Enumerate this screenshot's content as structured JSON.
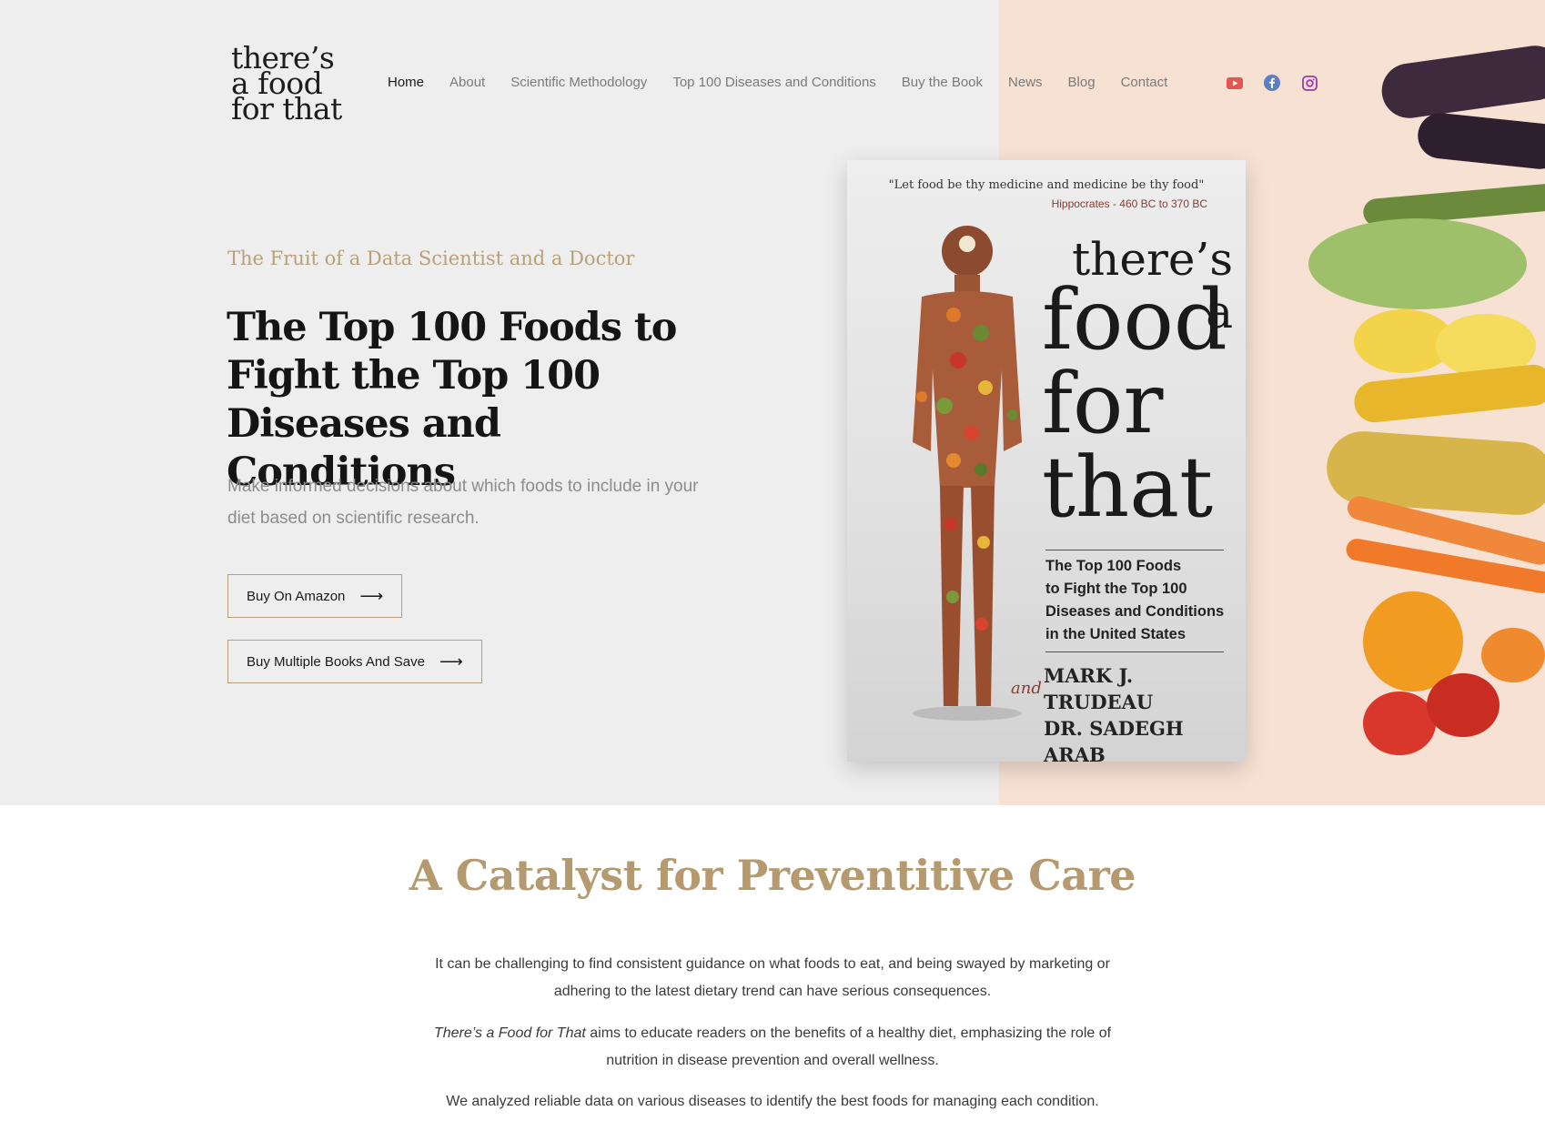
{
  "logo": {
    "lines": [
      "there’s",
      "a food",
      "for that"
    ]
  },
  "nav": {
    "items": [
      {
        "label": "Home",
        "active": true
      },
      {
        "label": "About"
      },
      {
        "label": "Scientific Methodology"
      },
      {
        "label": "Top 100 Diseases and Conditions"
      },
      {
        "label": "Buy the Book"
      },
      {
        "label": "News"
      },
      {
        "label": "Blog"
      },
      {
        "label": "Contact"
      }
    ]
  },
  "social": [
    {
      "icon": "youtube-icon",
      "color": "#e4574f"
    },
    {
      "icon": "facebook-icon",
      "color": "#5a7fc4"
    },
    {
      "icon": "instagram-icon",
      "color": "#9b3ba8"
    }
  ],
  "hero": {
    "eyebrow": "The Fruit of a Data Scientist and a Doctor",
    "headline": "The Top 100 Foods to Fight the Top 100 Diseases and Conditions",
    "lede": "Make informed decisions about which foods to include in your diet based on scientific research.",
    "buttons": [
      {
        "label": "Buy On Amazon",
        "arrow": "⟶"
      },
      {
        "label": "Buy Multiple Books And Save",
        "arrow": "⟶"
      }
    ]
  },
  "book": {
    "quote": "\"Let food be thy medicine and medicine be thy food\"",
    "quote_source": "Hippocrates - 460 BC to 370 BC",
    "title_line1": "there’s a",
    "title_line2": "food",
    "title_line3": "for",
    "title_line4": "that",
    "subtitle_lines": [
      "The Top 100 Foods",
      "to Fight the Top 100",
      "Diseases and Conditions",
      "in the United States"
    ],
    "and_word": "and",
    "author1": "MARK J. TRUDEAU",
    "author2": "DR. SADEGH ARAB"
  },
  "catalyst": {
    "heading": "A Catalyst for Preventitive Care",
    "p1": "It can be challenging to find consistent guidance on what foods to eat, and being swayed by marketing or adhering to the latest dietary trend can have serious consequences.",
    "p2_em": "There’s a Food for That",
    "p2_rest": " aims to educate readers on the benefits of a healthy diet, emphasizing the role of nutrition in disease prevention and overall wellness.",
    "p3": "We analyzed reliable data on various diseases to identify the best foods for managing each condition."
  },
  "colors": {
    "accent": "#b59a70",
    "hero_bg": "#efeeee",
    "peach_bg": "#f7e1d3"
  }
}
